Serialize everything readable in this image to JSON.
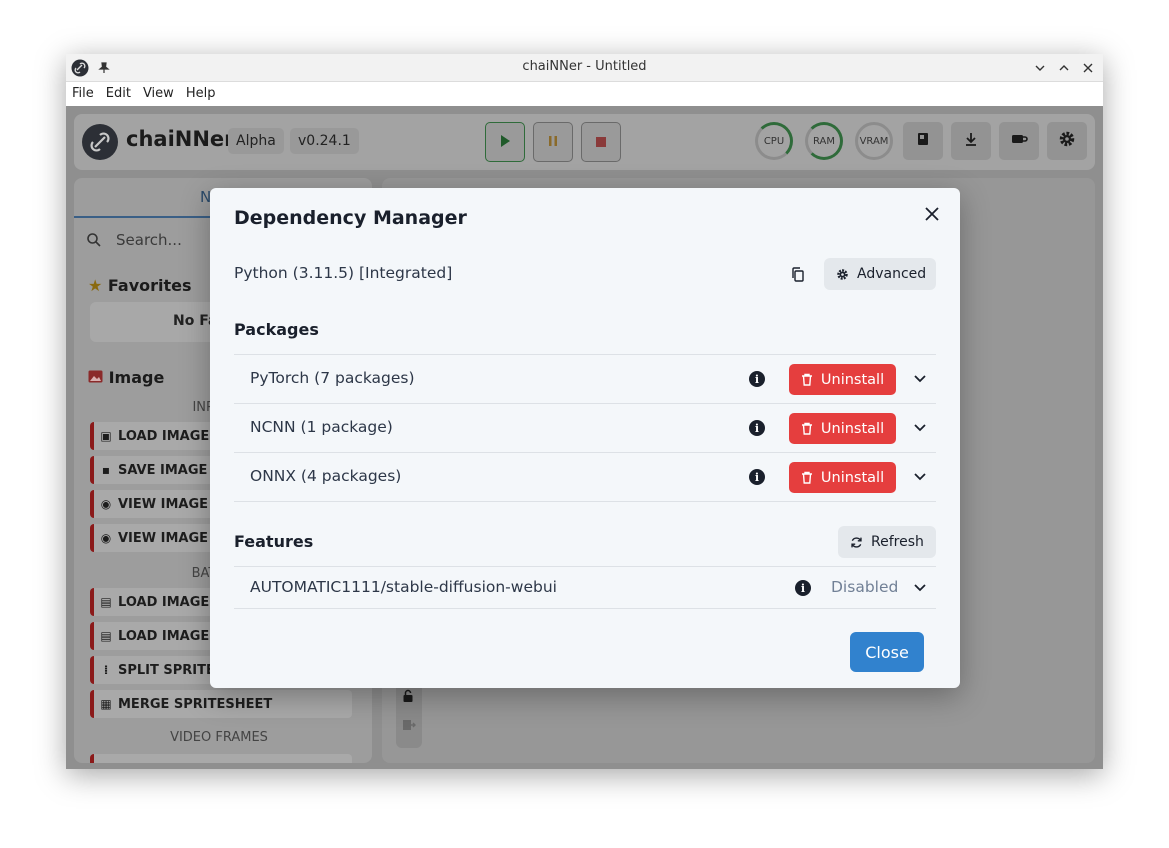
{
  "window": {
    "title": "chaiNNer - Untitled",
    "menu": [
      "File",
      "Edit",
      "View",
      "Help"
    ]
  },
  "header": {
    "app_name": "chaiNNer",
    "channel": "Alpha",
    "version": "v0.24.1",
    "gauges": [
      "CPU",
      "RAM",
      "VRAM"
    ]
  },
  "sidebar": {
    "tab_label": "N",
    "search_placeholder": "Search...",
    "favorites_title": "Favorites",
    "favorites_empty": "No Fa",
    "image_title": "Image",
    "cat_input": "INPUT &",
    "cat_batch": "BATCH P",
    "cat_video": "VIDEO FRAMES",
    "items": [
      {
        "label": "LOAD IMAGE",
        "icon": "image-icon"
      },
      {
        "label": "SAVE IMAGE",
        "icon": "floppy-icon"
      },
      {
        "label": "VIEW IMAGE",
        "icon": "eye-icon"
      },
      {
        "label": "VIEW IMAGE",
        "icon": "eye-icon"
      },
      {
        "label": "LOAD IMAGE",
        "icon": "images-icon"
      },
      {
        "label": "LOAD IMAGE",
        "icon": "images-icon"
      },
      {
        "label": "SPLIT SPRITE",
        "icon": "grid-icon"
      },
      {
        "label": "MERGE SPRITESHEET",
        "icon": "table-icon"
      }
    ]
  },
  "modal": {
    "title": "Dependency Manager",
    "python_label": "Python (3.11.5) [Integrated]",
    "advanced_label": "Advanced",
    "packages_heading": "Packages",
    "packages": [
      {
        "name": "PyTorch (7 packages)",
        "action": "Uninstall"
      },
      {
        "name": "NCNN (1 package)",
        "action": "Uninstall"
      },
      {
        "name": "ONNX (4 packages)",
        "action": "Uninstall"
      }
    ],
    "features_heading": "Features",
    "refresh_label": "Refresh",
    "features": [
      {
        "name": "AUTOMATIC1111/stable-diffusion-webui",
        "status": "Disabled"
      }
    ],
    "close_label": "Close"
  },
  "colors": {
    "uninstall": "#e53e3e",
    "primary": "#3182ce",
    "modal_bg": "#f4f7fa"
  }
}
